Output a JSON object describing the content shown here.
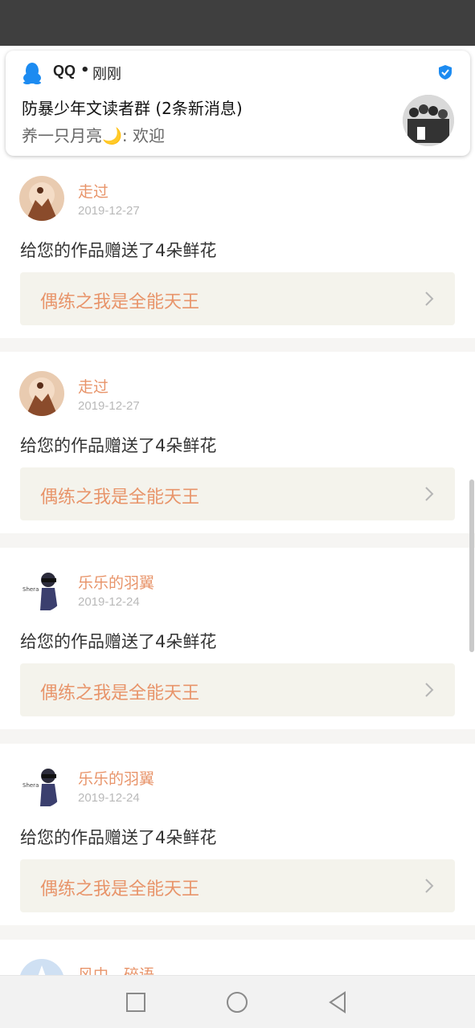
{
  "notification": {
    "app_name": "QQ",
    "separator": "•",
    "time": "刚刚",
    "title": "防暴少年文读者群 (2条新消息)",
    "body": "养一只月亮🌙: 欢迎",
    "accent_color": "#1c8bf1"
  },
  "gifts": [
    {
      "user": "走过",
      "date": "2019-12-27",
      "message": "给您的作品赠送了4朵鲜花",
      "work_title": "偶练之我是全能天王"
    },
    {
      "user": "走过",
      "date": "2019-12-27",
      "message": "给您的作品赠送了4朵鲜花",
      "work_title": "偶练之我是全能天王"
    },
    {
      "user": "乐乐的羽翼",
      "date": "2019-12-24",
      "message": "给您的作品赠送了4朵鲜花",
      "work_title": "偶练之我是全能天王"
    },
    {
      "user": "乐乐的羽翼",
      "date": "2019-12-24",
      "message": "给您的作品赠送了4朵鲜花",
      "work_title": "偶练之我是全能天王"
    },
    {
      "user": "风中，碎语，",
      "date": "",
      "message": "",
      "work_title": ""
    }
  ],
  "nav": {
    "recent_icon": "square-icon",
    "home_icon": "circle-icon",
    "back_icon": "triangle-back-icon"
  },
  "colors": {
    "username": "#e8946a",
    "work_link_bg": "#f4f3ec",
    "status_bar": "#3f3f3f"
  }
}
